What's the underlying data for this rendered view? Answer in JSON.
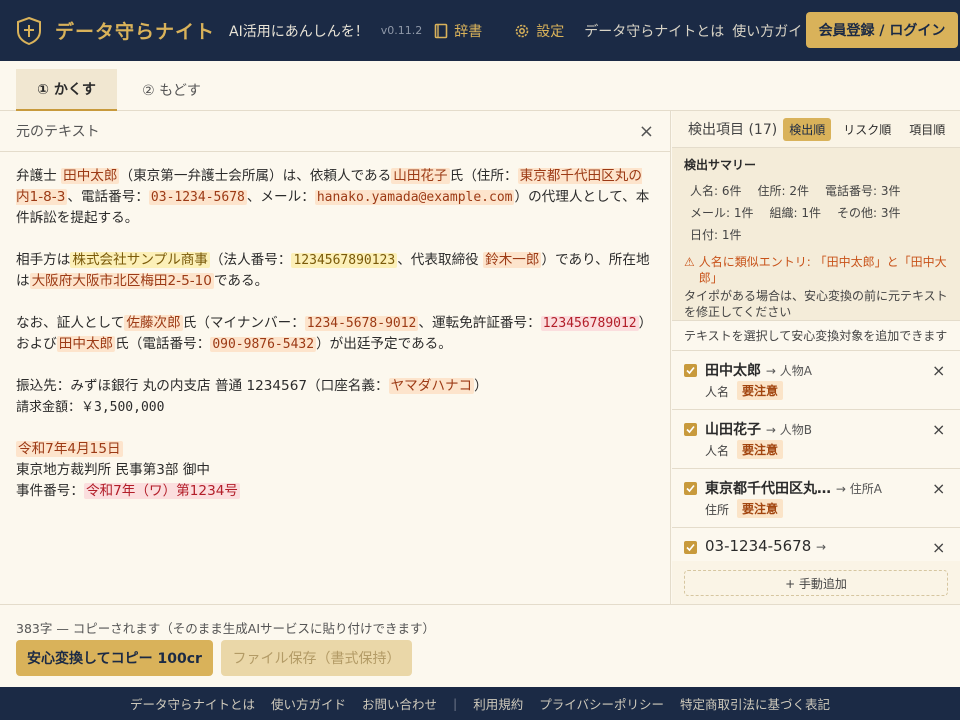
{
  "header": {
    "brand": "データ守らナイト",
    "tagline": "AI活用にあんしんを！",
    "version": "v0.11.2",
    "nav_dict": "辞書",
    "nav_settings": "設定",
    "link_about": "データ守らナイトとは",
    "link_guide": "使い方ガイド",
    "login": "会員登録 / ログイン"
  },
  "tabs": [
    "① かくす",
    "② もどす"
  ],
  "editor": {
    "title": "元のテキスト",
    "close": "×",
    "p1": {
      "a": "弁護士 ",
      "b": "田中太郎",
      "c": "（東京第一弁護士会所属）は、依頼人である",
      "d": "山田花子",
      "e": "氏（住所：",
      "f": "東京都千代田区丸の内1-8-3",
      "g": "、電話番号：",
      "h": "03-1234-5678",
      "i": "、メール：",
      "j": "hanako.yamada@example.com",
      "k": "）の代理人として、本件訴訟を提起する。"
    },
    "p2": {
      "a": "相手方は",
      "b": "株式会社サンプル商事",
      "c": "（法人番号：",
      "d": "1234567890123",
      "e": "、代表取締役 ",
      "f": "鈴木一郎",
      "g": "）であり、所在地は",
      "h": "大阪府大阪市北区梅田2-5-10",
      "i": "である。"
    },
    "p3": {
      "a": "なお、証人として",
      "b": "佐藤次郎",
      "c": "氏（マイナンバー：",
      "d": "1234-5678-9012",
      "e": "、運転免許証番号：",
      "f": "123456789012",
      "g": "）および",
      "h": "田中太郎",
      "i": "氏（電話番号：",
      "j": "090-9876-5432",
      "k": "）が出廷予定である。"
    },
    "p4": {
      "a": "振込先：みずほ銀行 丸の内支店 普通 1234567（口座名義：",
      "b": "ヤマダハナコ",
      "c": "）",
      "d": "請求金額：￥3,500,000"
    },
    "p5": {
      "date": "令和7年4月15日",
      "court": "東京地方裁判所 民事第3部 御中",
      "case_label": "事件番号：",
      "case_no": "令和7年（ワ）第1234号"
    }
  },
  "bottom": {
    "note": "383字 — コピーされます（そのまま生成AIサービスに貼り付けできます）",
    "btn_main": "安心変換してコピー 100cr",
    "btn_file": "ファイル保存（書式保持）"
  },
  "footer": [
    "データ守らナイトとは",
    "使い方ガイド",
    "お問い合わせ",
    "利用規約",
    "プライバシーポリシー",
    "特定商取引法に基づく表記"
  ],
  "footer_sep": "|",
  "panel": {
    "title": "検出項目 (17)",
    "sorts": [
      "検出順",
      "リスク順",
      "項目順"
    ],
    "summary_title": "検出サマリー",
    "summary": [
      "人名: 6件",
      "住所: 2件",
      "電話番号: 3件",
      "メール: 1件",
      "組織: 1件",
      "その他: 3件",
      "日付: 1件"
    ],
    "warn": "人名に類似エントリ: 「田中太郎」と「田中大郎」",
    "warn_note": "タイポがある場合は、安心変換の前に元テキストを修正してください",
    "hint": "テキストを選択して安心変換対象を追加できます",
    "items": [
      {
        "name": "田中太郎",
        "to": "→ 人物A",
        "cat": "人名",
        "badge": "要注意"
      },
      {
        "name": "山田花子",
        "to": "→ 人物B",
        "cat": "人名",
        "badge": "要注意"
      },
      {
        "name": "東京都千代田区丸…",
        "to": "→ 住所A",
        "cat": "住所",
        "badge": "要注意"
      },
      {
        "name": "03-1234-5678",
        "to": "→",
        "cat": "",
        "badge": ""
      }
    ],
    "manual": "+ 手動追加"
  }
}
